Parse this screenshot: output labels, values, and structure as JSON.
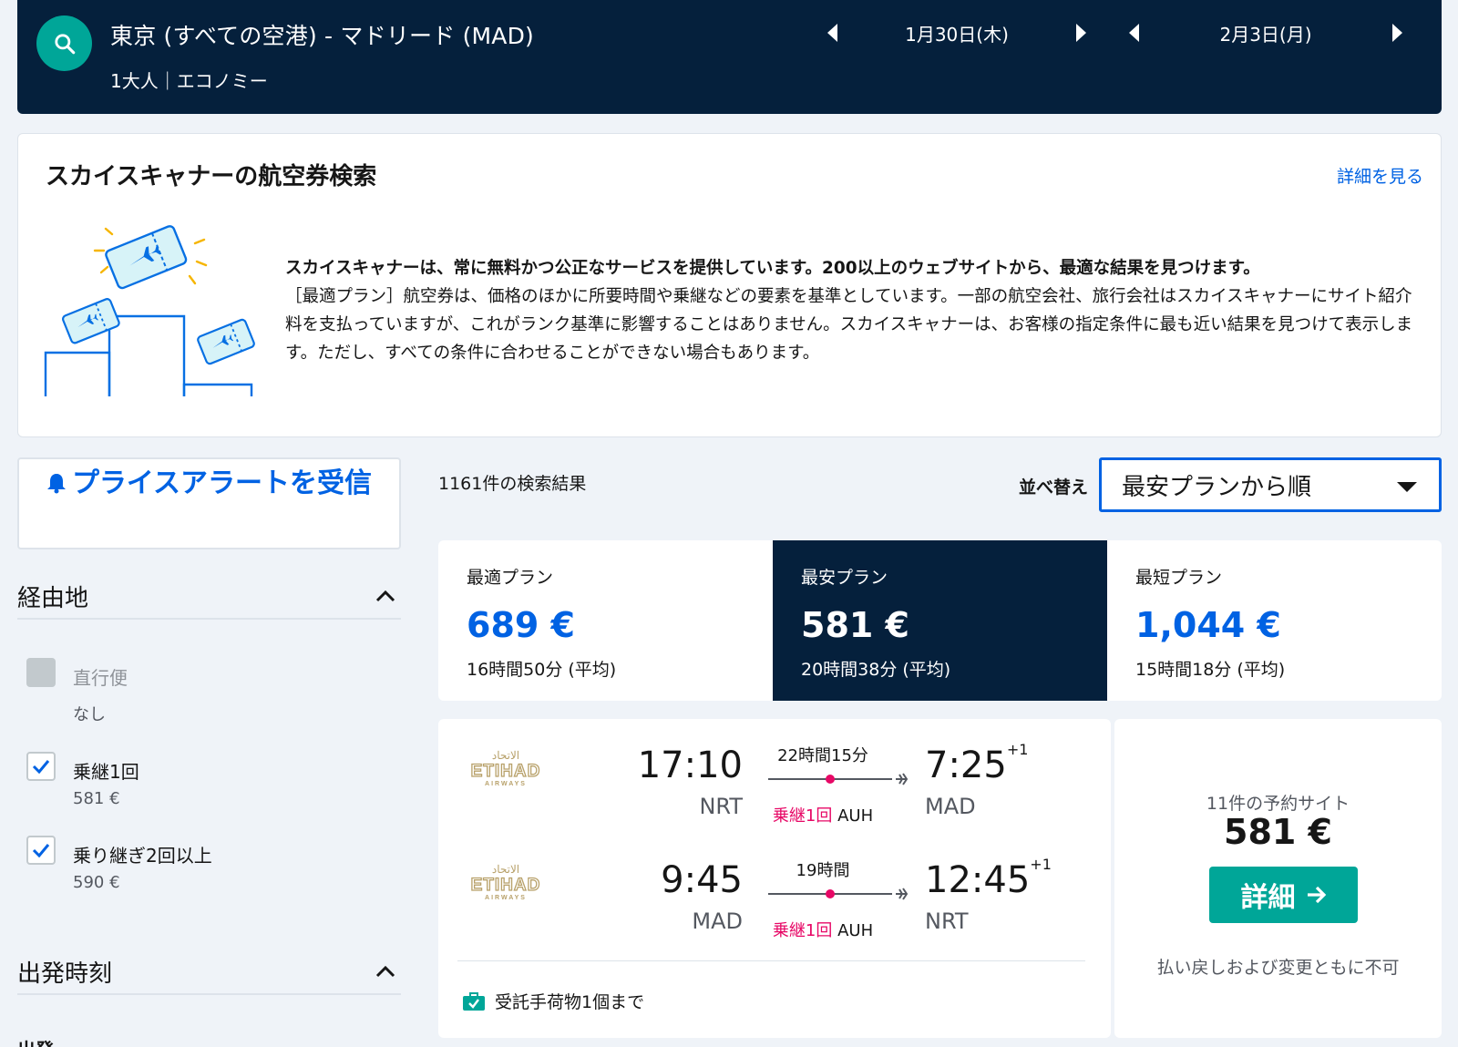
{
  "header": {
    "route": "東京 (すべての空港) - マドリード (MAD)",
    "passengers": "1大人｜エコノミー",
    "depart_date": "1月30日(木)",
    "return_date": "2月3日(月)"
  },
  "info": {
    "title": "スカイスキャナーの航空券検索",
    "link": "詳細を見る",
    "lead": "スカイスキャナーは、常に無料かつ公正なサービスを提供しています。200以上のウェブサイトから、最適な結果を見つけます。",
    "body": "［最適プラン］航空券は、価格のほかに所要時間や乗継などの要素を基準としています。一部の航空会社、旅行会社はスカイスキャナーにサイト紹介料を支払っていますが、これがランク基準に影響することはありません。スカイスキャナーは、お客様の指定条件に最も近い結果を見つけて表示します。ただし、すべての条件に合わせることができない場合もあります。"
  },
  "alert": {
    "label": "プライスアラートを受信"
  },
  "filters": {
    "stops_title": "経由地",
    "options": [
      {
        "label": "直行便",
        "sub": "なし",
        "checked": false
      },
      {
        "label": "乗継1回",
        "sub": "581 €",
        "checked": true
      },
      {
        "label": "乗り継ぎ2回以上",
        "sub": "590 €",
        "checked": true
      }
    ],
    "time_title": "出発時刻",
    "cut_label": "出発"
  },
  "results": {
    "count": "1161件の検索結果",
    "sort_label": "並べ替え",
    "sort_value": "最安プランから順"
  },
  "tabs": [
    {
      "label": "最適プラン",
      "price": "689 €",
      "duration": "16時間50分 (平均)"
    },
    {
      "label": "最安プラン",
      "price": "581 €",
      "duration": "20時間38分 (平均)"
    },
    {
      "label": "最短プラン",
      "price": "1,044 €",
      "duration": "15時間18分 (平均)"
    }
  ],
  "card": {
    "airline": "ETIHAD AIRWAYS",
    "outbound": {
      "dep_time": "17:10",
      "dep_code": "NRT",
      "duration": "22時間15分",
      "stops": "乗継1回",
      "via": "AUH",
      "arr_time": "7:25",
      "arr_plus": "+1",
      "arr_code": "MAD"
    },
    "inbound": {
      "dep_time": "9:45",
      "dep_code": "MAD",
      "duration": "19時間",
      "stops": "乗継1回",
      "via": "AUH",
      "arr_time": "12:45",
      "arr_plus": "+1",
      "arr_code": "NRT"
    },
    "baggage": "受託手荷物1個まで",
    "sites": "11件の予約サイト",
    "price": "581 €",
    "detail_button": "詳細",
    "refund": "払い戻しおよび変更ともに不可"
  },
  "colors": {
    "navy": "#05203c",
    "teal": "#00a698",
    "blue": "#0062e3",
    "stop_red": "#e70866"
  }
}
